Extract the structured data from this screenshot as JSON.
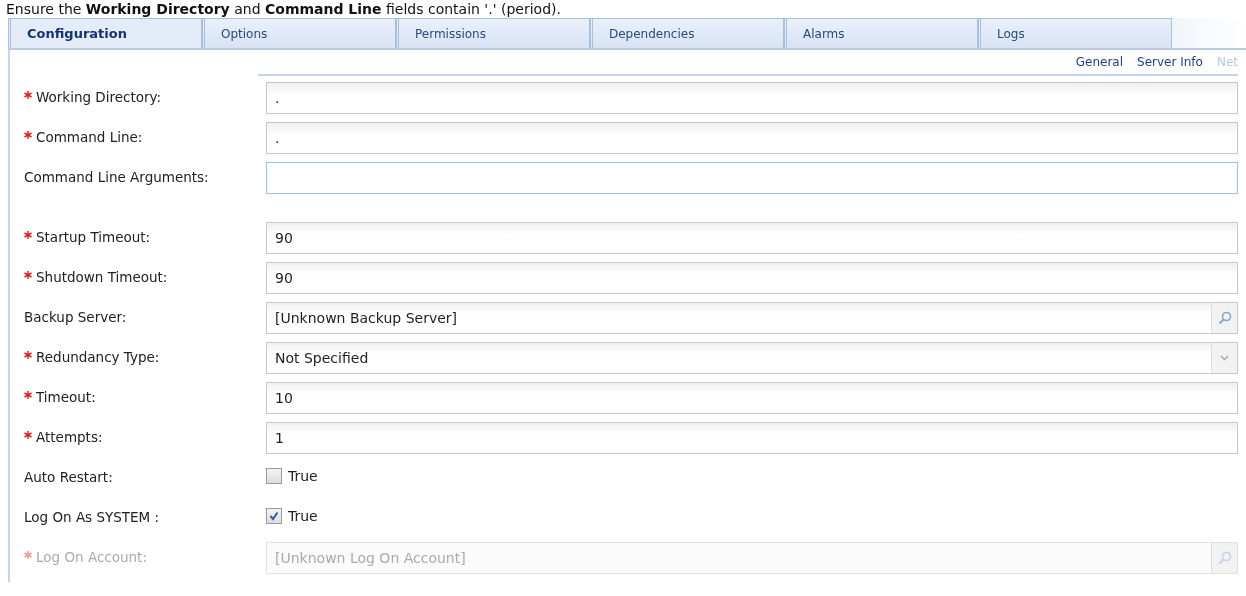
{
  "instruction": "Ensure the **Working Directory** and **Command Line** fields contain '.' (period).",
  "tabs": [
    {
      "label": "Configuration",
      "selected": true
    },
    {
      "label": "Options",
      "selected": false
    },
    {
      "label": "Permissions",
      "selected": false
    },
    {
      "label": "Dependencies",
      "selected": false
    },
    {
      "label": "Alarms",
      "selected": false
    },
    {
      "label": "Logs",
      "selected": false
    }
  ],
  "subnav": [
    {
      "label": "General",
      "disabled": false
    },
    {
      "label": "Server Info",
      "disabled": false
    },
    {
      "label": "Net",
      "disabled": true
    }
  ],
  "fields": [
    {
      "kind": "text",
      "label": "Working Directory:",
      "required": true,
      "value": ".",
      "disabled": false
    },
    {
      "kind": "text",
      "label": "Command Line:",
      "required": true,
      "value": ".",
      "disabled": false
    },
    {
      "kind": "text",
      "label": "Command Line Arguments:",
      "required": false,
      "disabled": false,
      "focused": true
    },
    {
      "kind": "text",
      "label": "Startup Timeout:",
      "required": true,
      "value": "90",
      "disabled": false
    },
    {
      "kind": "text",
      "label": "Shutdown Timeout:",
      "required": true,
      "value": "90",
      "disabled": false
    },
    {
      "kind": "lookup",
      "label": "Backup Server:",
      "required": false,
      "value": "[Unknown Backup Server]",
      "disabled": false
    },
    {
      "kind": "dropdown",
      "label": "Redundancy Type:",
      "required": true,
      "value": "Not Specified",
      "disabled": false
    },
    {
      "kind": "text",
      "label": "Timeout:",
      "required": true,
      "value": "10",
      "disabled": false
    },
    {
      "kind": "text",
      "label": "Attempts:",
      "required": true,
      "value": "1",
      "disabled": false
    },
    {
      "kind": "checkbox",
      "label": "Auto Restart:",
      "required": false,
      "value": "True",
      "checked": false,
      "disabled": false
    },
    {
      "kind": "checkbox",
      "label": "Log On As SYSTEM :",
      "required": false,
      "value": "True",
      "checked": true,
      "disabled": false
    },
    {
      "kind": "lookup",
      "label": "Log On Account:",
      "required": true,
      "value": "[Unknown Log On Account]",
      "disabled": true
    }
  ]
}
